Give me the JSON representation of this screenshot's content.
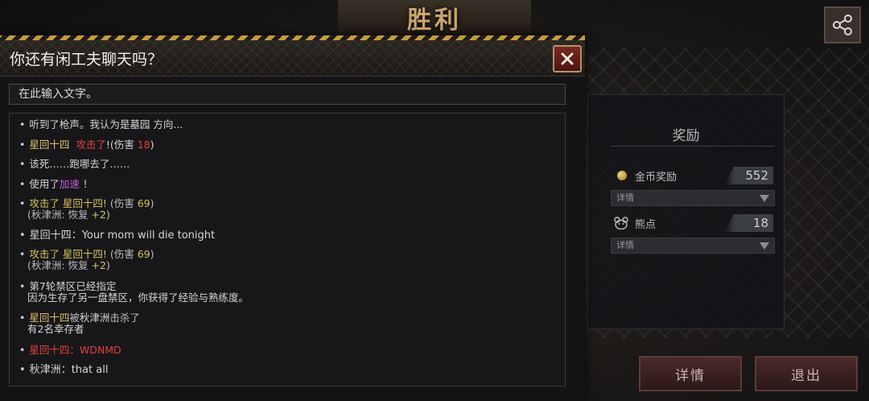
{
  "screen": {
    "banner_title": "胜利",
    "share_icon": "share-icon"
  },
  "reward_panel": {
    "title": "奖励",
    "coin_row": {
      "label": "金币奖励",
      "value": "552",
      "icon": "coin-icon"
    },
    "coin_detail": "详情",
    "bear_row": {
      "label": "熊点",
      "value": "18",
      "icon": "bear-icon"
    },
    "bear_detail": "详情"
  },
  "buttons": {
    "details": "详情",
    "exit": "退出"
  },
  "chat_dialog": {
    "title": "你还有闲工夫聊天吗？",
    "close_icon": "close-icon",
    "input_placeholder": "在此输入文字。",
    "colors": {
      "hazard_yellow": "#c89a3c",
      "attack_yellow": "#d8c35a",
      "damage_red": "#e2413a",
      "buff_purple": "#c65bd8"
    },
    "messages": [
      {
        "text": "听到了枪声。我认为是墓园 方向..."
      },
      {
        "player": "星回十四",
        "action": "攻击了",
        "suffix": "!(伤害 ",
        "damage": "18",
        "end": ")"
      },
      {
        "text": "该死……跑哪去了……"
      },
      {
        "prefix": "使用了",
        "skill": "加速",
        "end": " ！"
      },
      {
        "line1_action": "攻击了 星回十四!",
        "line1_suffix": " (伤害 ",
        "line1_damage": "69",
        "line1_end": ")",
        "line2_prefix": "(秋津洲: 恢复 ",
        "line2_value": "+2",
        "line2_end": ")"
      },
      {
        "player": "星回十四",
        "sep": "：",
        "text": "Your mom will die tonight"
      },
      {
        "line1_action": "攻击了 星回十四!",
        "line1_suffix": " (伤害 ",
        "line1_damage": "69",
        "line1_end": ")",
        "line2_prefix": "(秋津洲: 恢复 ",
        "line2_value": "+2",
        "line2_end": ")"
      },
      {
        "line1": "第7轮禁区已经指定",
        "line2": "因为生存了另一盘禁区，你获得了经验与熟练度。"
      },
      {
        "line1_player": "星回十四",
        "line1_mid": "被",
        "line1_killer": "秋津洲",
        "line1_end": "击杀了",
        "line2": "有2名幸存者"
      },
      {
        "text": "星回十四：WDNMD"
      },
      {
        "player": "秋津洲",
        "sep": "：",
        "text": "that all"
      }
    ]
  }
}
